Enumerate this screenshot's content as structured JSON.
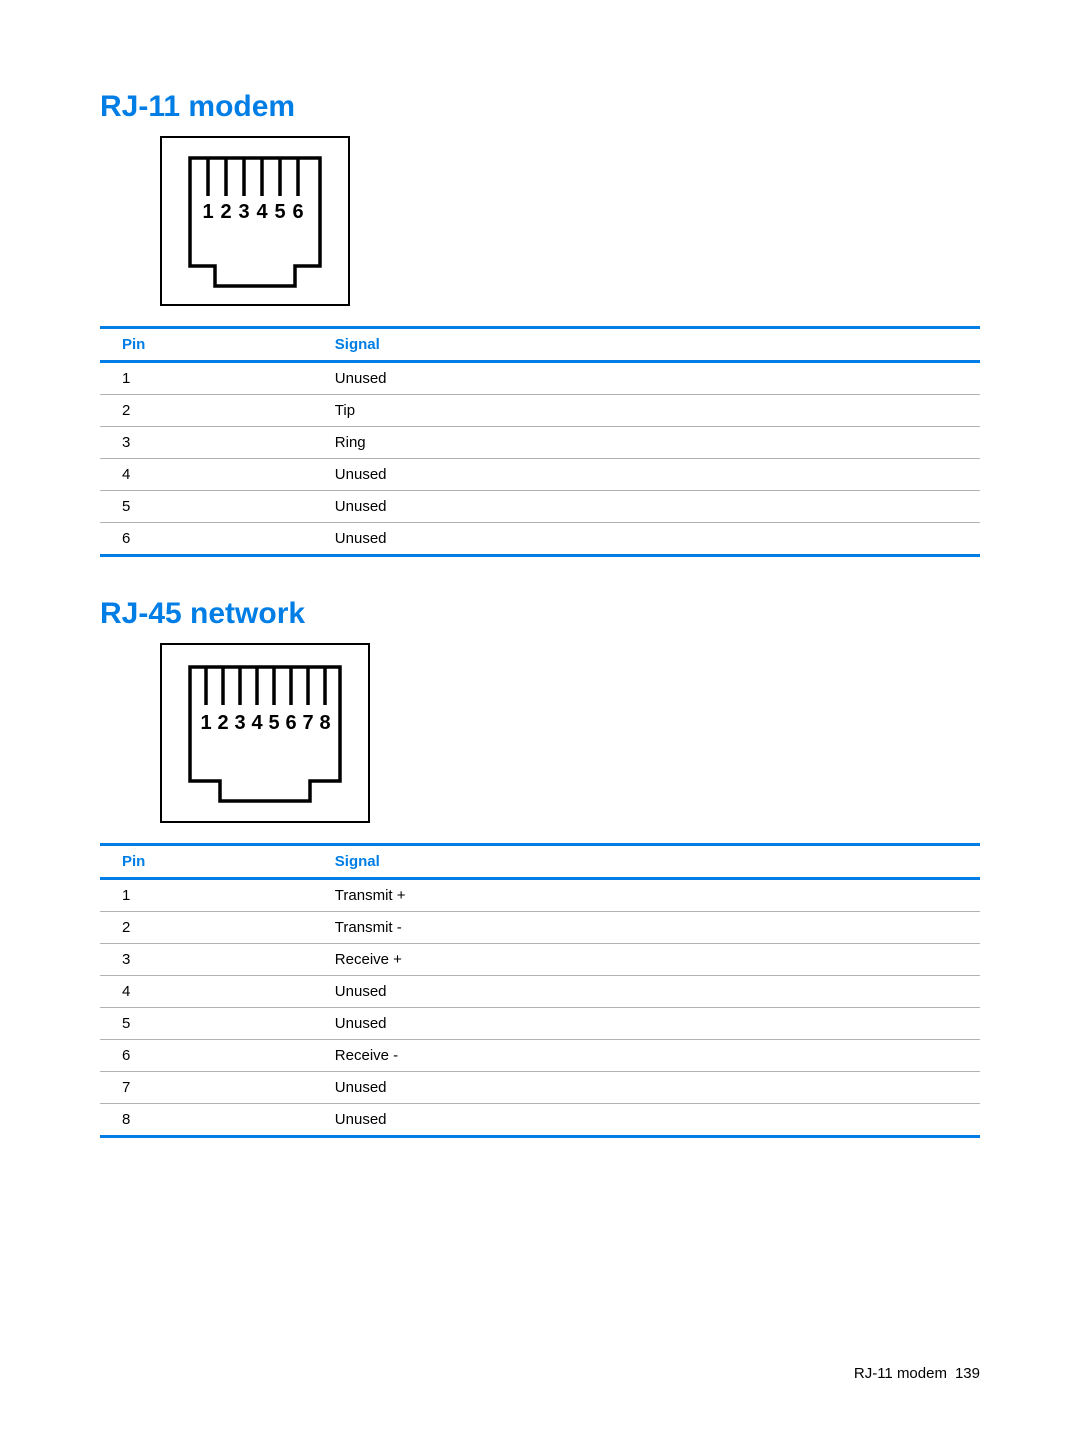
{
  "sections": [
    {
      "title": "RJ-11 modem",
      "connector": {
        "pins": 6,
        "labels": [
          "1",
          "2",
          "3",
          "4",
          "5",
          "6"
        ]
      },
      "table": {
        "headers": {
          "pin": "Pin",
          "signal": "Signal"
        },
        "rows": [
          {
            "pin": "1",
            "signal": "Unused"
          },
          {
            "pin": "2",
            "signal": "Tip"
          },
          {
            "pin": "3",
            "signal": "Ring"
          },
          {
            "pin": "4",
            "signal": "Unused"
          },
          {
            "pin": "5",
            "signal": "Unused"
          },
          {
            "pin": "6",
            "signal": "Unused"
          }
        ]
      }
    },
    {
      "title": "RJ-45 network",
      "connector": {
        "pins": 8,
        "labels": [
          "1",
          "2",
          "3",
          "4",
          "5",
          "6",
          "7",
          "8"
        ]
      },
      "table": {
        "headers": {
          "pin": "Pin",
          "signal": "Signal"
        },
        "rows": [
          {
            "pin": "1",
            "signal": "Transmit +"
          },
          {
            "pin": "2",
            "signal": "Transmit -"
          },
          {
            "pin": "3",
            "signal": "Receive +"
          },
          {
            "pin": "4",
            "signal": "Unused"
          },
          {
            "pin": "5",
            "signal": "Unused"
          },
          {
            "pin": "6",
            "signal": "Receive -"
          },
          {
            "pin": "7",
            "signal": "Unused"
          },
          {
            "pin": "8",
            "signal": "Unused"
          }
        ]
      }
    }
  ],
  "footer": {
    "text": "RJ-11 modem",
    "page": "139"
  }
}
